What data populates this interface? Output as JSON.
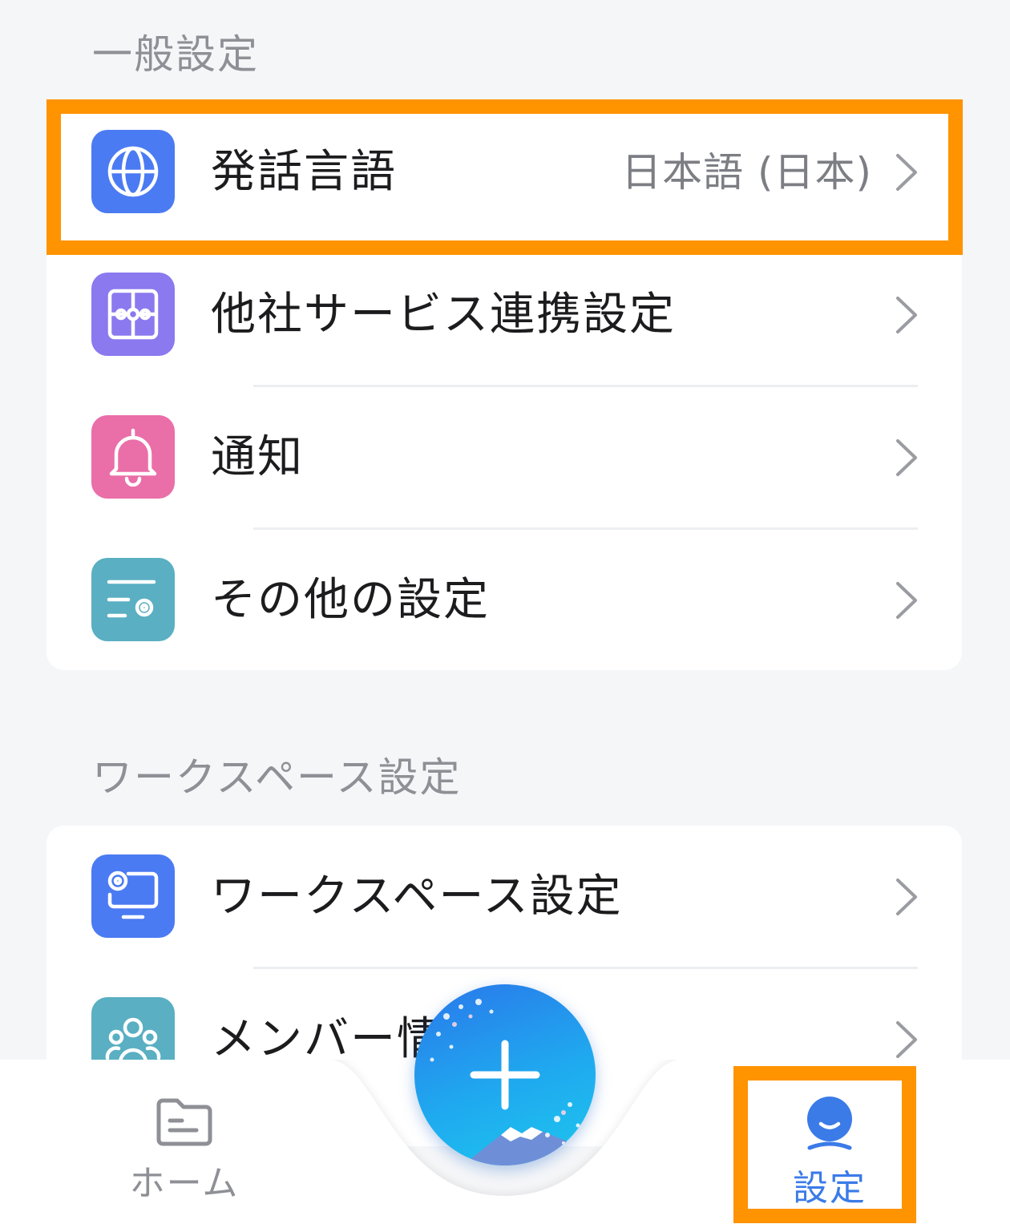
{
  "general_section": {
    "title": "一般設定",
    "items": [
      {
        "label": "発話言語",
        "value": "日本語 (日本)",
        "icon": "globe-icon",
        "icon_color": "#4b7bf2"
      },
      {
        "label": "他社サービス連携設定",
        "icon": "puzzle-icon",
        "icon_color": "#8b79ef"
      },
      {
        "label": "通知",
        "icon": "bell-icon",
        "icon_color": "#ea6ea8"
      },
      {
        "label": "その他の設定",
        "icon": "settings-list-icon",
        "icon_color": "#5aafc2"
      }
    ]
  },
  "workspace_section": {
    "title": "ワークスペース設定",
    "items": [
      {
        "label": "ワークスペース設定",
        "icon": "monitor-gear-icon",
        "icon_color": "#4b7bf2"
      },
      {
        "label": "メンバー情",
        "icon": "members-icon",
        "icon_color": "#5aafc2"
      }
    ]
  },
  "tabbar": {
    "home_label": "ホーム",
    "settings_label": "設定",
    "add_button": "plus-icon"
  },
  "colors": {
    "highlight": "#ff9300",
    "active_tab": "#3b7be8",
    "inactive_tab": "#8e9096"
  }
}
